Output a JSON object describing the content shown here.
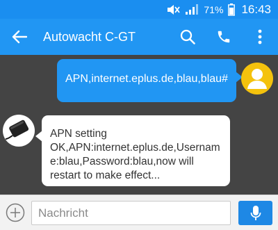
{
  "status_bar": {
    "battery": "71%",
    "time": "16:43",
    "icons": [
      "mute-icon",
      "signal-icon",
      "battery-icon"
    ]
  },
  "app_bar": {
    "title": "Autowacht C-GT",
    "icons": [
      "back-arrow-icon",
      "search-icon",
      "phone-icon",
      "more-vert-icon"
    ]
  },
  "messages": [
    {
      "direction": "outgoing",
      "text": "APN,internet.eplus.de,blau,blau#"
    },
    {
      "direction": "incoming",
      "lines": [
        "APN setting",
        "OK,APN:internet.eplus.de,Usernam",
        "e:blau,Password:blau,now will",
        "restart to make effect..."
      ]
    }
  ],
  "composer": {
    "placeholder": "Nachricht",
    "value": ""
  },
  "colors": {
    "status_bar": "#1a8ef0",
    "app_bar": "#2196f3",
    "chat_background": "#444444",
    "outgoing_bubble": "#2196f3",
    "incoming_bubble": "#ffffff",
    "user_avatar": "#f4c20d",
    "mic_button": "#1e88e5"
  }
}
